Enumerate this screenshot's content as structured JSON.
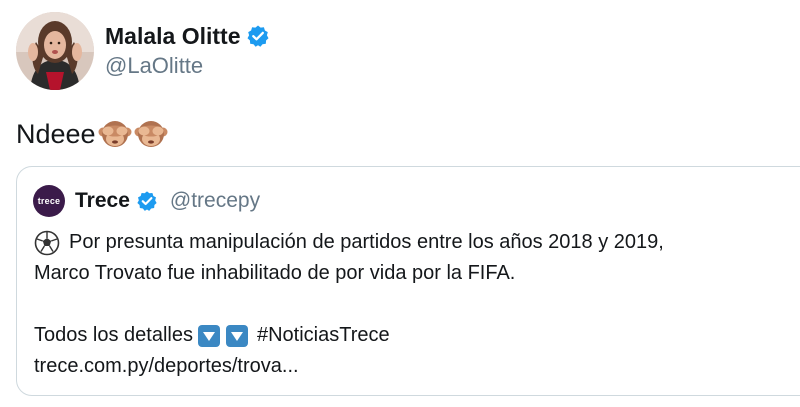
{
  "author": {
    "display_name": "Malala Olitte",
    "handle": "@LaOlitte",
    "verified": true,
    "avatar": "profile-photo"
  },
  "tweet": {
    "text": "Ndeee",
    "emojis": [
      "see-no-evil-monkey-icon",
      "see-no-evil-monkey-icon"
    ]
  },
  "quoted_tweet": {
    "display_name": "Trece",
    "handle": "@trecepy",
    "verified": true,
    "avatar_label": "trece",
    "line1": "Por presunta manipulación de partidos entre los años 2018 y 2019,",
    "line2": "Marco Trovato fue inhabilitado de por vida por la FIFA.",
    "details_label": "Todos los detalles",
    "hashtag": "#NoticiasTrece",
    "link": "trece.com.py/deportes/trova..."
  },
  "colors": {
    "verified_blue": "#1d9bf0",
    "secondary_text": "#657786",
    "border": "#cfd9de",
    "trece_brand": "#3b1b4a"
  }
}
